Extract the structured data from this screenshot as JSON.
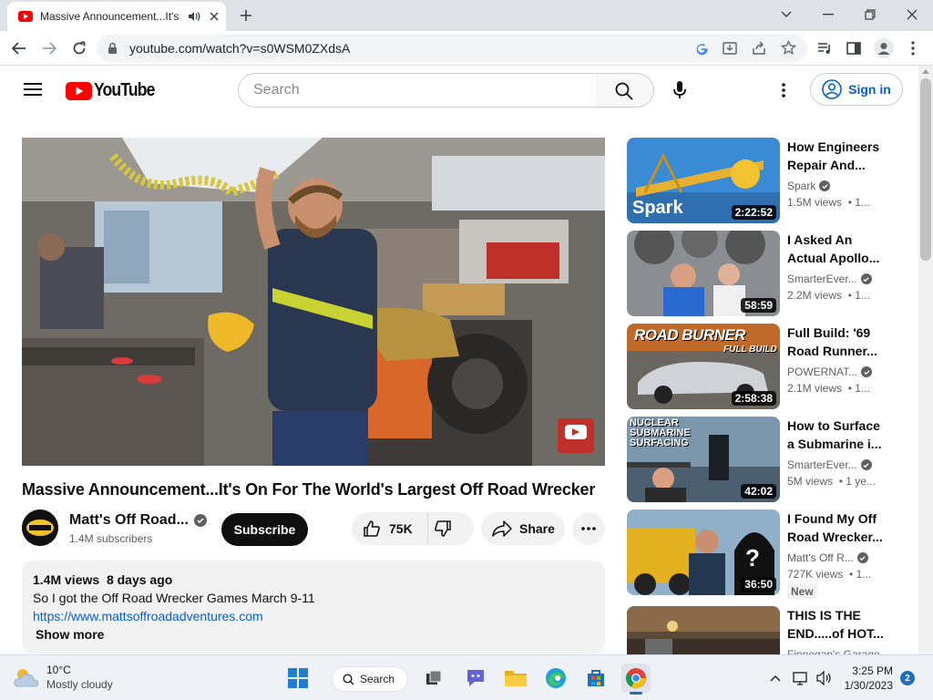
{
  "browser": {
    "tab_title": "Massive Announcement...It's",
    "url": "youtube.com/watch?v=s0WSM0ZXdsA"
  },
  "youtube": {
    "logo_text": "YouTube",
    "search_placeholder": "Search",
    "signin_label": "Sign in",
    "video": {
      "title": "Massive Announcement...It's On For The World's Largest Off Road Wrecker",
      "channel": "Matt's Off Road...",
      "subscribers": "1.4M subscribers",
      "subscribe_label": "Subscribe",
      "likes": "75K",
      "share_label": "Share"
    },
    "description": {
      "views": "1.4M views",
      "age": "8 days ago",
      "text": "So I got the Off Road Wrecker Games March 9-11",
      "link": "https://www.mattsoffroadadventures.com",
      "show_more": "Show more"
    },
    "recommendations": [
      {
        "title": "How Engineers Repair And...",
        "channel": "Spark",
        "views": "1.5M views",
        "age": "• 1...",
        "duration": "2:22:52",
        "thumb_text": "Spark",
        "verified": true
      },
      {
        "title": "I Asked An Actual Apollo...",
        "channel": "SmarterEver...",
        "views": "2.2M views",
        "age": "• 1...",
        "duration": "58:59",
        "thumb_text": "",
        "verified": true
      },
      {
        "title": "Full Build: '69 Road Runner...",
        "channel": "POWERNAT...",
        "views": "2.1M views",
        "age": "• 1...",
        "duration": "2:58:38",
        "thumb_text": "ROAD BURNER",
        "thumb_sub": "FULL BUILD",
        "verified": true
      },
      {
        "title": "How to Surface a Submarine i...",
        "channel": "SmarterEver...",
        "views": "5M views",
        "age": "• 1 ye...",
        "duration": "42:02",
        "thumb_text": "NUCLEAR SUBMARINE SURFACING",
        "verified": true
      },
      {
        "title": "I Found My Off Road Wrecker...",
        "channel": "Matt's Off R...",
        "views": "727K views",
        "age": "• 1...",
        "duration": "36:50",
        "thumb_text": "?",
        "badge": "New",
        "verified": true
      },
      {
        "title": "THIS IS THE END.....of HOT...",
        "channel": "Finnegan's Garage",
        "views": "",
        "age": "",
        "duration": "",
        "thumb_text": "",
        "verified": false
      }
    ]
  },
  "taskbar": {
    "weather_temp": "10°C",
    "weather_desc": "Mostly cloudy",
    "search_label": "Search",
    "time": "3:25 PM",
    "date": "1/30/2023",
    "notification_count": "2"
  }
}
